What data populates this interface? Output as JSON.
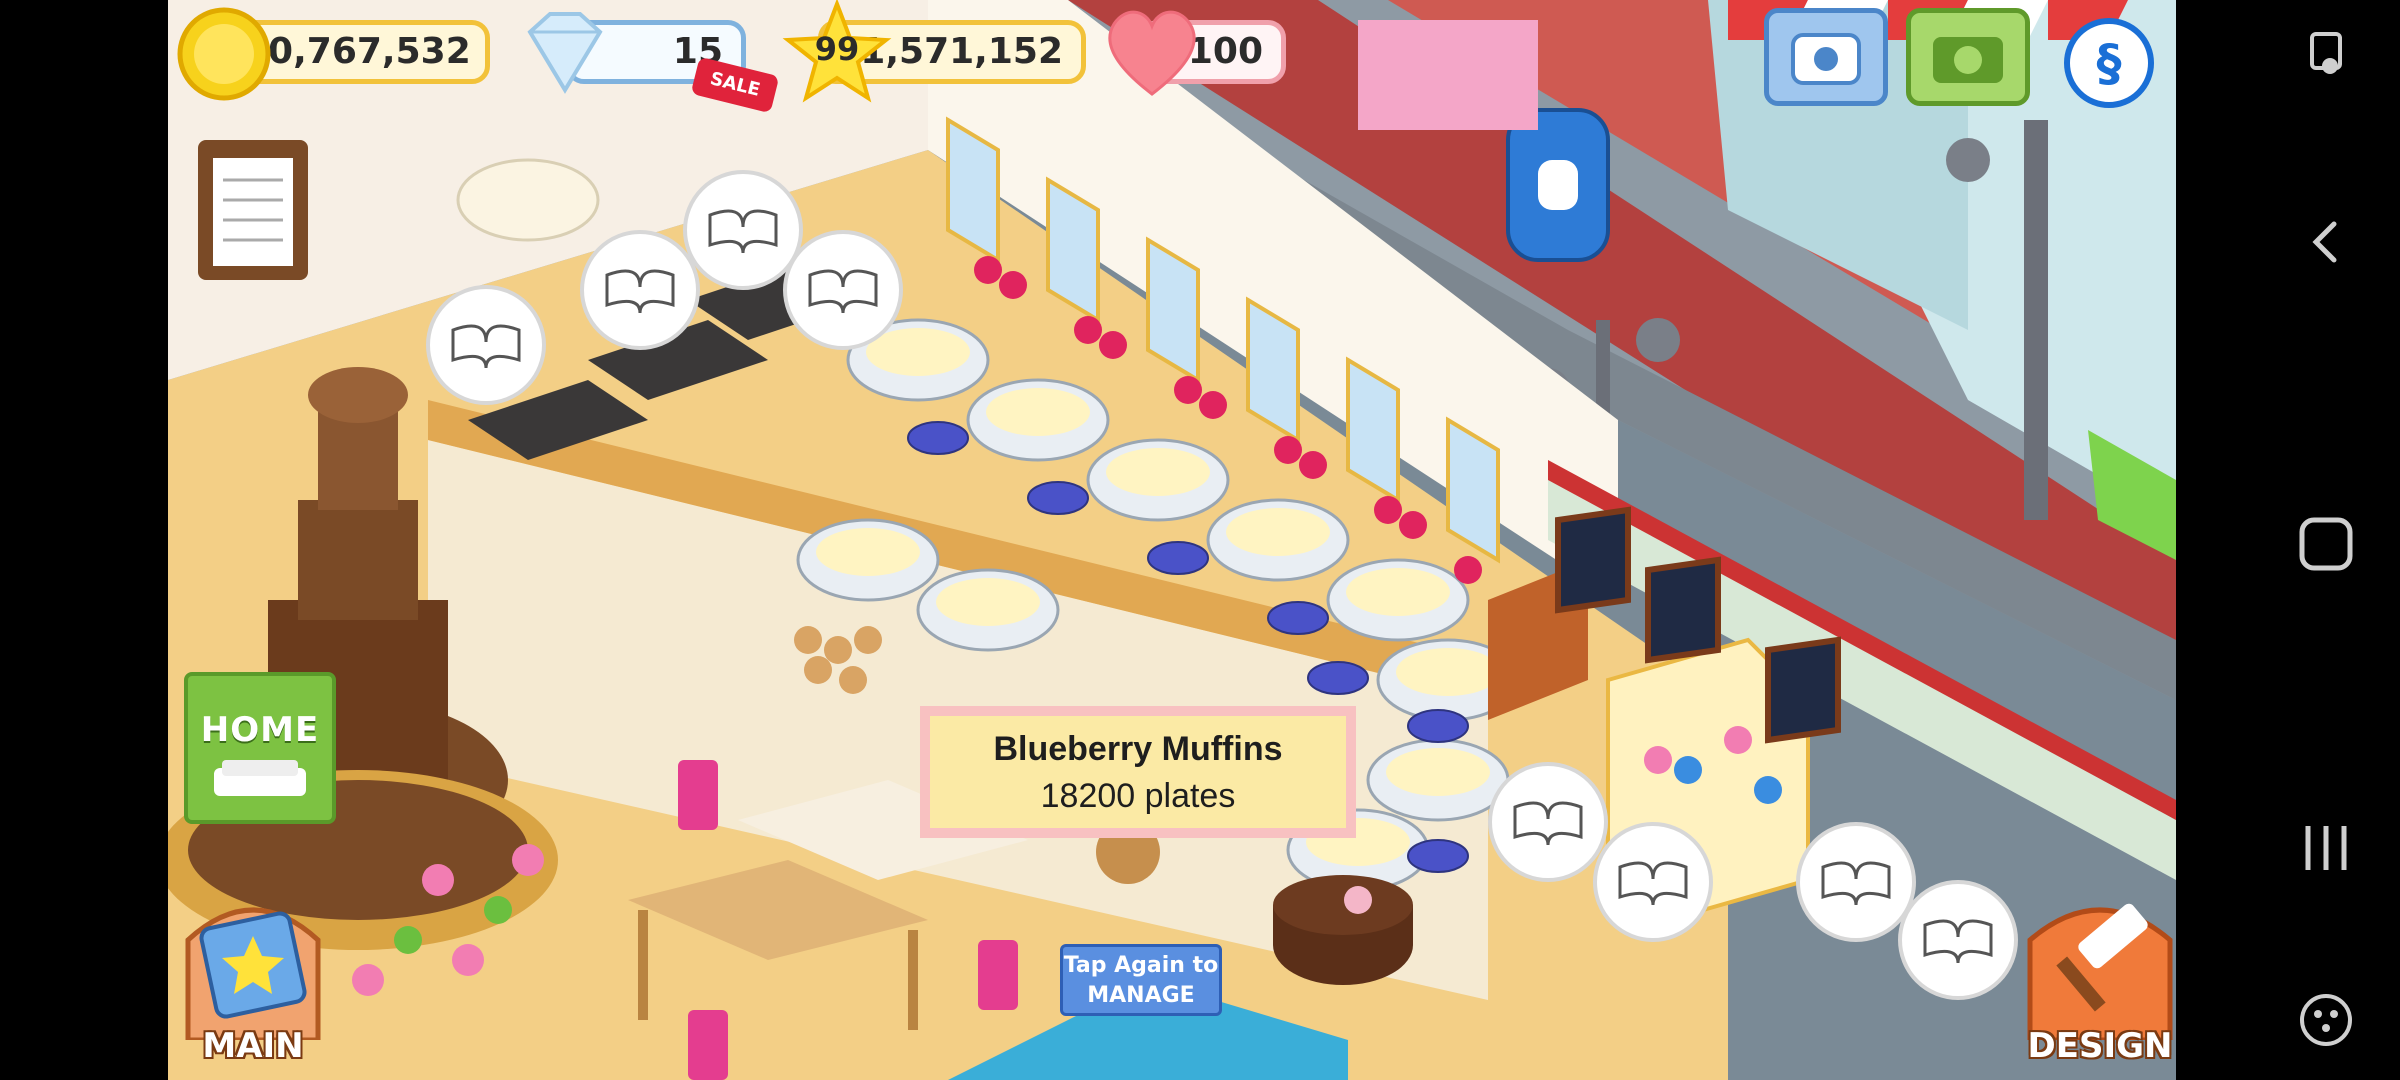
{
  "hud": {
    "coins": "20,767,532",
    "gems": "15",
    "level": "99",
    "xp": "1,571,152",
    "hearts": "100",
    "sale_tag": "SALE"
  },
  "tooltip": {
    "title": "Blueberry Muffins",
    "subtitle": "18200 plates"
  },
  "tap_again": {
    "line1": "Tap Again to",
    "line2": "MANAGE"
  },
  "buttons": {
    "home": "HOME",
    "main": "MAIN",
    "design": "DESIGN"
  },
  "icons": {
    "phone": "phone-icon",
    "camera": "camera-icon",
    "social": "social-s-icon",
    "recipe_book": "recipe-book-icon"
  },
  "colors": {
    "accent_gold": "#f2c23a",
    "home_green": "#7dc242",
    "design_orange": "#f07a3a"
  },
  "system_nav": {
    "screenshot": "screenshot-icon",
    "back": "back-icon",
    "home": "home-icon",
    "recents": "recents-icon",
    "game_tools": "game-tools-icon"
  }
}
